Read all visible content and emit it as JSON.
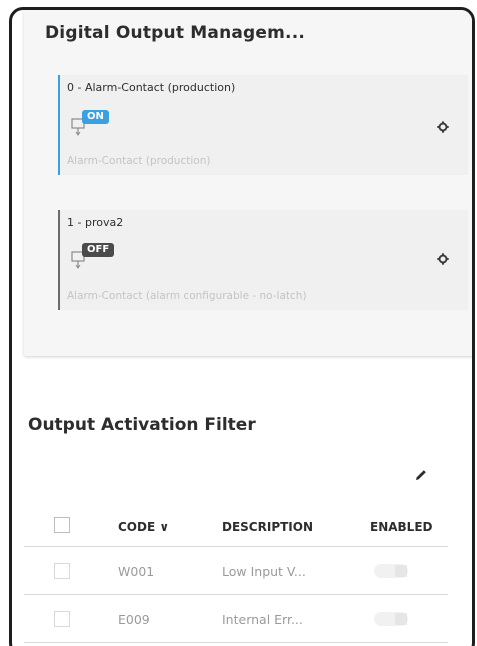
{
  "panel": {
    "title": "Digital Output Managem..."
  },
  "outputs": [
    {
      "title": "0 - Alarm-Contact (production)",
      "state": "ON",
      "subtitle": "Alarm-Contact (production)",
      "accent": "#3aa0e2"
    },
    {
      "title": "1 - prova2",
      "state": "OFF",
      "subtitle": "Alarm-Contact (alarm configurable - no-latch)",
      "accent": "#6b6b6b"
    }
  ],
  "filter": {
    "title": "Output Activation Filter",
    "columns": {
      "code": "CODE ∨",
      "description": "DESCRIPTION",
      "enabled": "ENABLED"
    },
    "rows": [
      {
        "code": "W001",
        "description": "Low Input V...",
        "enabled": false
      },
      {
        "code": "E009",
        "description": "Internal Err...",
        "enabled": false
      }
    ]
  },
  "icons": {
    "settings": "gear-icon",
    "edit": "pencil-icon",
    "contact": "relay-contact-icon"
  }
}
